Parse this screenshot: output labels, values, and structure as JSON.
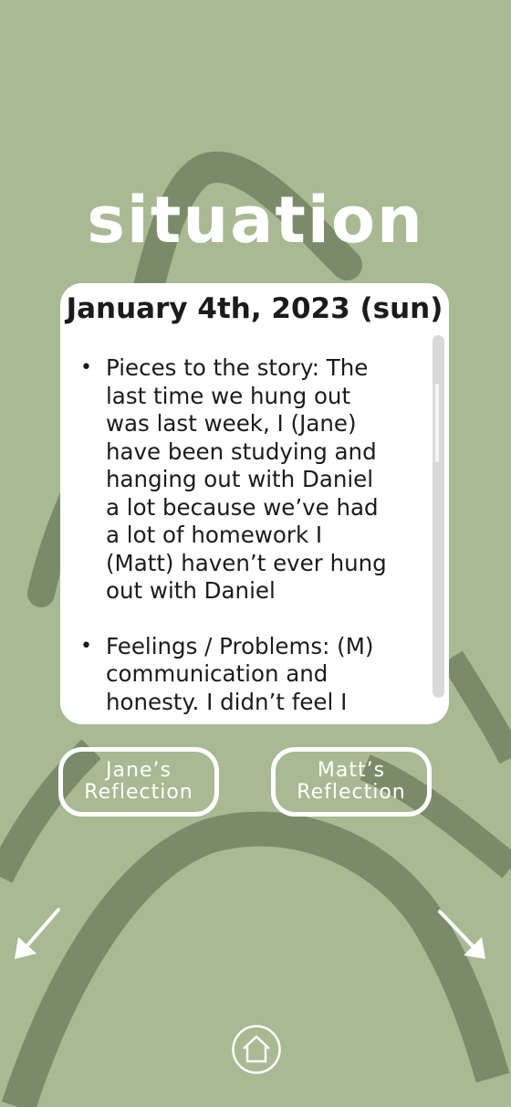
{
  "header": {
    "title": "situation"
  },
  "entry_card": {
    "date": "January 4th, 2023 (sun)",
    "items": [
      {
        "text": "Pieces to the story: The\nlast time we hung out\nwas last week, I (Jane)\nhave been studying and\nhanging out with Daniel\na lot because we’ve had\na lot of homework  I\n(Matt) haven’t ever hung\nout with Daniel"
      },
      {
        "text": "Feelings / Problems: (M)\ncommunication and\nhonesty. I didn’t feel I"
      }
    ]
  },
  "reflections": {
    "jane": {
      "line1": "Jane’s",
      "line2": "Reflection"
    },
    "matt": {
      "line1": "Matt’s",
      "line2": "Reflection"
    }
  },
  "navigation": {
    "prev_icon": "arrow-down-left-icon",
    "next_icon": "arrow-down-right-icon",
    "home_icon": "home-icon"
  },
  "colors": {
    "background": "#a9b993",
    "brush_stroke": "#7b8b6a",
    "card": "#ffffff",
    "text": "#1b1b1b"
  }
}
